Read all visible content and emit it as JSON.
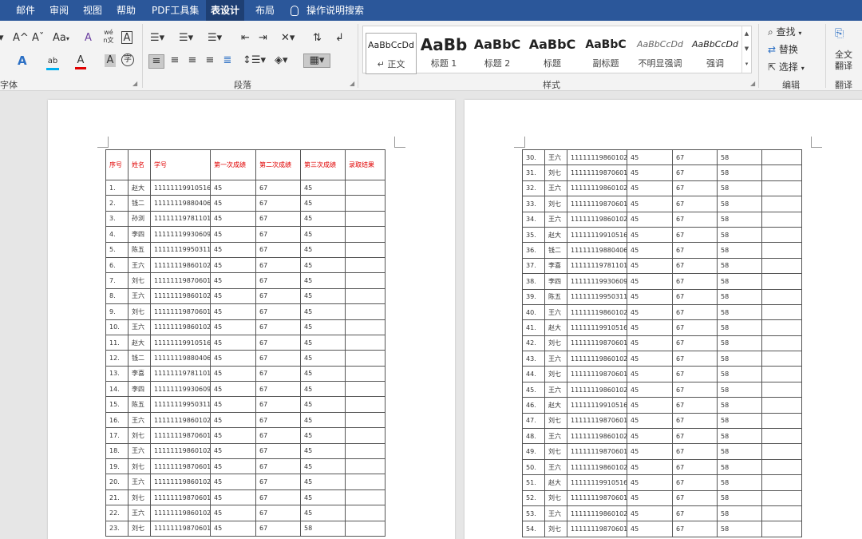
{
  "tabs": [
    "邮件",
    "审阅",
    "视图",
    "帮助",
    "PDF工具集",
    "表设计",
    "布局",
    "操作说明搜索"
  ],
  "active_tab": "表设计",
  "ribbon": {
    "font_group": {
      "label": "字体",
      "grow_font": "A^",
      "shrink_font": "Aˇ",
      "change_case": "Aa",
      "clear_format": "A",
      "phonetic": "wén文",
      "char_border": "A",
      "text_effect": "A",
      "highlight": "ab",
      "font_color": "A",
      "char_shading": "A",
      "enclose_char": "字",
      "highlight_color": "#00b0f0",
      "font_color_value": "#e00000"
    },
    "paragraph_group": {
      "label": "段落"
    },
    "styles_group": {
      "label": "样式",
      "styles": [
        {
          "preview": "AaBbCcDd",
          "name": "正文"
        },
        {
          "preview": "AaBb",
          "name": "标题 1"
        },
        {
          "preview": "AaBbC",
          "name": "标题 2"
        },
        {
          "preview": "AaBbC",
          "name": "标题"
        },
        {
          "preview": "AaBbC",
          "name": "副标题"
        },
        {
          "preview": "AaBbCcDd",
          "name": "不明显强调"
        },
        {
          "preview": "AaBbCcDd",
          "name": "强调"
        }
      ]
    },
    "editing_group": {
      "label": "编辑",
      "find": "查找",
      "replace": "替换",
      "select": "选择"
    },
    "translate_group": {
      "label": "翻译",
      "full_text_1": "全文",
      "full_text_2": "翻译"
    }
  },
  "table_left": {
    "headers": [
      "序号",
      "姓名",
      "学号",
      "第一次成绩",
      "第二次成绩",
      "第三次成绩",
      "录取结果"
    ],
    "rows": [
      [
        "1.",
        "赵大",
        "11111119910516",
        "45",
        "67",
        "45",
        ""
      ],
      [
        "2.",
        "钱二",
        "11111119880406",
        "45",
        "67",
        "45",
        ""
      ],
      [
        "3.",
        "孙浏",
        "11111119781101",
        "45",
        "67",
        "45",
        ""
      ],
      [
        "4.",
        "李四",
        "11111119930609",
        "45",
        "67",
        "45",
        ""
      ],
      [
        "5.",
        "陈五",
        "11111119950311",
        "45",
        "67",
        "45",
        ""
      ],
      [
        "6.",
        "王六",
        "11111119860102",
        "45",
        "67",
        "45",
        ""
      ],
      [
        "7.",
        "刘七",
        "11111119870601",
        "45",
        "67",
        "45",
        ""
      ],
      [
        "8.",
        "王六",
        "11111119860102",
        "45",
        "67",
        "45",
        ""
      ],
      [
        "9.",
        "刘七",
        "11111119870601",
        "45",
        "67",
        "45",
        ""
      ],
      [
        "10.",
        "王六",
        "11111119860102",
        "45",
        "67",
        "45",
        ""
      ],
      [
        "11.",
        "赵大",
        "11111119910516",
        "45",
        "67",
        "45",
        ""
      ],
      [
        "12.",
        "钱二",
        "11111119880406",
        "45",
        "67",
        "45",
        ""
      ],
      [
        "13.",
        "李喜",
        "11111119781101",
        "45",
        "67",
        "45",
        ""
      ],
      [
        "14.",
        "李四",
        "11111119930609",
        "45",
        "67",
        "45",
        ""
      ],
      [
        "15.",
        "陈五",
        "11111119950311",
        "45",
        "67",
        "45",
        ""
      ],
      [
        "16.",
        "王六",
        "11111119860102",
        "45",
        "67",
        "45",
        ""
      ],
      [
        "17.",
        "刘七",
        "11111119870601",
        "45",
        "67",
        "45",
        ""
      ],
      [
        "18.",
        "王六",
        "11111119860102",
        "45",
        "67",
        "45",
        ""
      ],
      [
        "19.",
        "刘七",
        "11111119870601",
        "45",
        "67",
        "45",
        ""
      ],
      [
        "20.",
        "王六",
        "11111119860102",
        "45",
        "67",
        "45",
        ""
      ],
      [
        "21.",
        "刘七",
        "11111119870601",
        "45",
        "67",
        "45",
        ""
      ],
      [
        "22.",
        "王六",
        "11111119860102",
        "45",
        "67",
        "45",
        ""
      ],
      [
        "23.",
        "刘七",
        "11111119870601",
        "45",
        "67",
        "58",
        ""
      ]
    ]
  },
  "table_right": {
    "rows": [
      [
        "30.",
        "王六",
        "11111119860102",
        "45",
        "67",
        "58",
        ""
      ],
      [
        "31.",
        "刘七",
        "11111119870601",
        "45",
        "67",
        "58",
        ""
      ],
      [
        "32.",
        "王六",
        "11111119860102",
        "45",
        "67",
        "58",
        ""
      ],
      [
        "33.",
        "刘七",
        "11111119870601",
        "45",
        "67",
        "58",
        ""
      ],
      [
        "34.",
        "王六",
        "11111119860102",
        "45",
        "67",
        "58",
        ""
      ],
      [
        "35.",
        "赵大",
        "11111119910516",
        "45",
        "67",
        "58",
        ""
      ],
      [
        "36.",
        "钱二",
        "11111119880406",
        "45",
        "67",
        "58",
        ""
      ],
      [
        "37.",
        "李喜",
        "11111119781101",
        "45",
        "67",
        "58",
        ""
      ],
      [
        "38.",
        "李四",
        "11111119930609",
        "45",
        "67",
        "58",
        ""
      ],
      [
        "39.",
        "陈五",
        "11111119950311",
        "45",
        "67",
        "58",
        ""
      ],
      [
        "40.",
        "王六",
        "11111119860102",
        "45",
        "67",
        "58",
        ""
      ],
      [
        "41.",
        "赵大",
        "11111119910516",
        "45",
        "67",
        "58",
        ""
      ],
      [
        "42.",
        "刘七",
        "11111119870601",
        "45",
        "67",
        "58",
        ""
      ],
      [
        "43.",
        "王六",
        "11111119860102",
        "45",
        "67",
        "58",
        ""
      ],
      [
        "44.",
        "刘七",
        "11111119870601",
        "45",
        "67",
        "58",
        ""
      ],
      [
        "45.",
        "王六",
        "11111119860102",
        "45",
        "67",
        "58",
        ""
      ],
      [
        "46.",
        "赵大",
        "11111119910516",
        "45",
        "67",
        "58",
        ""
      ],
      [
        "47.",
        "刘七",
        "11111119870601",
        "45",
        "67",
        "58",
        ""
      ],
      [
        "48.",
        "王六",
        "11111119860102",
        "45",
        "67",
        "58",
        ""
      ],
      [
        "49.",
        "刘七",
        "11111119870601",
        "45",
        "67",
        "58",
        ""
      ],
      [
        "50.",
        "王六",
        "11111119860102",
        "45",
        "67",
        "58",
        ""
      ],
      [
        "51.",
        "赵大",
        "11111119910516",
        "45",
        "67",
        "58",
        ""
      ],
      [
        "52.",
        "刘七",
        "11111119870601",
        "45",
        "67",
        "58",
        ""
      ],
      [
        "53.",
        "王六",
        "11111119860102",
        "45",
        "67",
        "58",
        ""
      ],
      [
        "54.",
        "刘七",
        "11111119870601",
        "45",
        "67",
        "58",
        ""
      ]
    ]
  }
}
